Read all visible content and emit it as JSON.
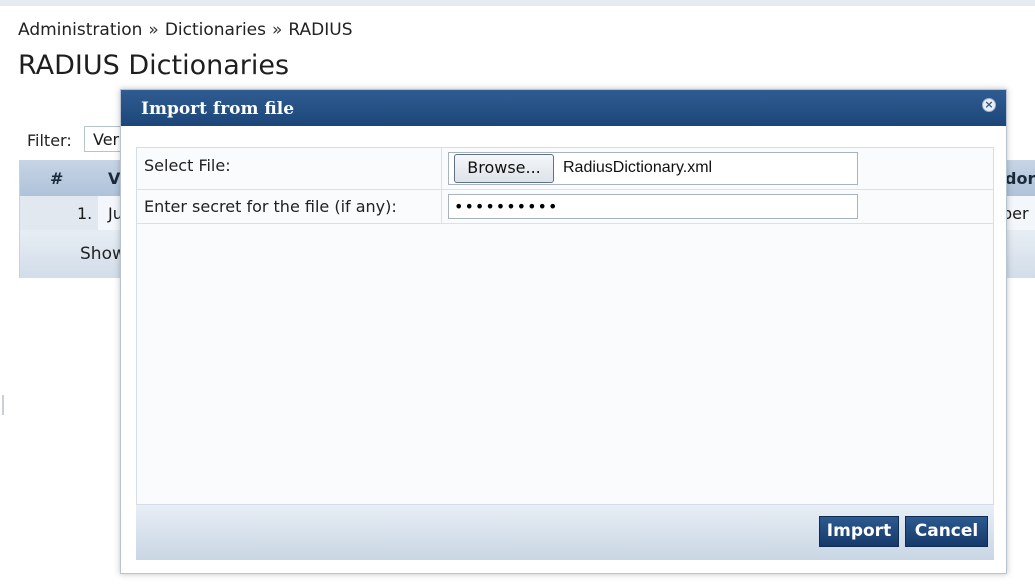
{
  "breadcrumb": {
    "item1": "Administration",
    "item2": "Dictionaries",
    "item3": "RADIUS",
    "separator": "»"
  },
  "page_title": "RADIUS Dictionaries",
  "filter": {
    "label": "Filter:",
    "value": "Ver"
  },
  "background_table": {
    "columns": {
      "hash": "#",
      "v": "V",
      "dor": "dor"
    },
    "row1": {
      "num": "1.",
      "cell": "Ju",
      "end": "ber"
    },
    "footer_text": "Show"
  },
  "dialog": {
    "title": "Import from file",
    "close_glyph": "×",
    "select_file_label": "Select File:",
    "browse_label": "Browse...",
    "file_name": "RadiusDictionary.xml",
    "secret_label": "Enter secret for the file (if any):",
    "secret_value": "••••••••••",
    "import_label": "Import",
    "cancel_label": "Cancel"
  },
  "colors": {
    "header": "#1c4679",
    "button": "#16396a",
    "table_header": "#aec2d9"
  }
}
